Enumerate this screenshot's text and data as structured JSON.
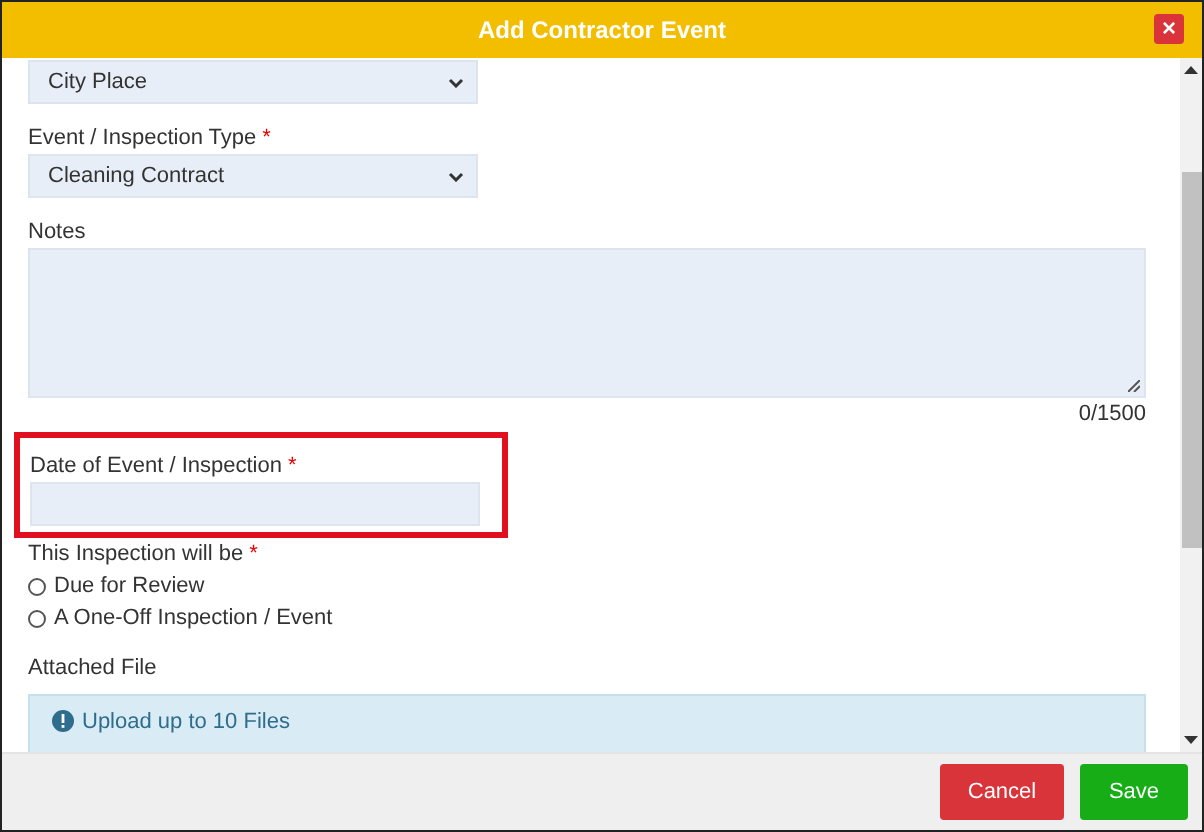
{
  "window": {
    "title": "Add Contractor Event",
    "close_label": "×"
  },
  "fields": [
    {
      "kind": "select",
      "value": "City Place"
    },
    {
      "kind": "select",
      "label": "Event / Inspection Type",
      "required_mark": "*",
      "value": "Cleaning Contract"
    },
    {
      "kind": "textarea",
      "label": "Notes",
      "counter": "0/1500"
    },
    {
      "kind": "date",
      "label": "Date of Event / Inspection",
      "required_mark": "*",
      "highlighted": true
    },
    {
      "kind": "radio",
      "label": "This Inspection will be",
      "required_mark": "*",
      "options": [
        {
          "label": "Due for Review",
          "selected": false
        },
        {
          "label": "A One-Off Inspection / Event",
          "selected": false
        }
      ]
    },
    {
      "kind": "upload",
      "label": "Attached File",
      "info": "Upload up to 10 Files"
    }
  ],
  "buttons": [
    {
      "kind": "cancel",
      "label": "Cancel"
    },
    {
      "kind": "save",
      "label": "Save"
    }
  ]
}
